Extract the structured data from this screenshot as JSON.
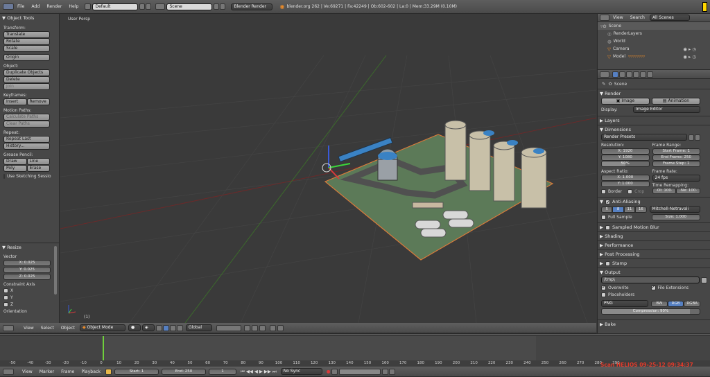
{
  "topbar": {
    "menus": [
      "File",
      "Add",
      "Render",
      "Help"
    ],
    "screen_layout": "Default",
    "scene": "Scene",
    "engine": "Blender Render",
    "stats": "blender.org 262 | Ve:69271 | Fa:42249 | Ob:602-602 | La:0 | Mem:33.29M (0.10M)"
  },
  "toolshelf": {
    "title": "Object Tools",
    "transform_label": "Transform:",
    "translate": "Translate",
    "rotate": "Rotate",
    "scale": "Scale",
    "origin": "Origin",
    "object_label": "Object:",
    "duplicate": "Duplicate Objects",
    "delete": "Delete",
    "join": "Join",
    "keyframes_label": "Keyframes:",
    "insert": "Insert",
    "remove": "Remove",
    "motion_label": "Motion Paths:",
    "calc_paths": "Calculate Paths",
    "clear_paths": "Clear Paths",
    "repeat_label": "Repeat:",
    "repeat_last": "Repeat Last",
    "history": "History...",
    "grease_label": "Grease Pencil:",
    "draw": "Draw",
    "line": "Line",
    "poly": "Poly",
    "erase": "Erase",
    "sketching": "Use Sketching Sessio",
    "resize_title": "Resize",
    "vector_label": "Vector",
    "vx": "X: 0.025",
    "vy": "Y: 0.025",
    "vz": "Z: 0.025",
    "constraint_label": "Constraint Axis",
    "cx": "X",
    "cy": "Y",
    "cz": "Z",
    "orientation_label": "Orientation"
  },
  "viewport": {
    "label": "User Persp",
    "object_label": "(1)",
    "header": {
      "menus": [
        "View",
        "Select",
        "Object"
      ],
      "mode": "Object Mode",
      "orientation": "Global"
    }
  },
  "outliner": {
    "menus": [
      "View",
      "Search"
    ],
    "filter": "All Scenes",
    "items": [
      "Scene",
      "RenderLayers",
      "World",
      "Camera",
      "Model"
    ]
  },
  "properties": {
    "breadcrumb": "Scene",
    "render_title": "Render",
    "image_btn": "Image",
    "animation_btn": "Animation",
    "display_label": "Display:",
    "display_value": "Image Editor",
    "layers": "Layers",
    "dimensions": "Dimensions",
    "presets": "Render Presets",
    "resolution_label": "Resolution:",
    "res_x": "X: 1920",
    "res_y": "Y: 1080",
    "res_pct": "50%",
    "frame_range_label": "Frame Range:",
    "start_frame": "Start Frame: 1",
    "end_frame": "End Frame: 250",
    "frame_step": "Frame Step: 1",
    "aspect_label": "Aspect Ratio:",
    "asp_x": "X: 1.000",
    "asp_y": "Y: 1.000",
    "frame_rate_label": "Frame Rate:",
    "fps": "24 fps",
    "time_remap_label": "Time Remapping:",
    "old": "·Ol: 100·",
    "new": "·Ne: 100·",
    "border": "Border",
    "crop": "Crop",
    "aa_title": "Anti-Aliasing",
    "aa_samples": [
      "5",
      "8",
      "11",
      "16"
    ],
    "aa_filter": "Mitchell-Netravali",
    "full_sample": "Full Sample",
    "size": "Size: 1.000",
    "smb": "Sampled Motion Blur",
    "shading": "Shading",
    "performance": "Performance",
    "post": "Post Processing",
    "stamp": "Stamp",
    "output_title": "Output",
    "output_path": "/tmp\\",
    "overwrite": "Overwrite",
    "file_ext": "File Extensions",
    "placeholders": "Placeholders",
    "format": "PNG",
    "bw": "BW",
    "rgb": "RGB",
    "rgba": "RGBA",
    "compression": "Compression: 90%",
    "bake": "Bake"
  },
  "timeline": {
    "ticks": [
      "-50",
      "-40",
      "-30",
      "-20",
      "-10",
      "0",
      "10",
      "20",
      "30",
      "40",
      "50",
      "60",
      "70",
      "80",
      "90",
      "100",
      "110",
      "120",
      "130",
      "140",
      "150",
      "160",
      "170",
      "180",
      "190",
      "200",
      "210",
      "220",
      "230",
      "240",
      "250",
      "260",
      "270",
      "280",
      "290"
    ],
    "current_frame": 1,
    "menus": [
      "View",
      "Marker",
      "Frame",
      "Playback"
    ],
    "start": "Start: 1",
    "end": "End: 250",
    "frame": "1",
    "sync": "No Sync",
    "watermark": "Scan HELIOS 09-25-12 09:34:37"
  },
  "colors": {
    "accent": "#5680c2",
    "watermark": "#e03a2a",
    "current_frame": "#6fd03c"
  }
}
